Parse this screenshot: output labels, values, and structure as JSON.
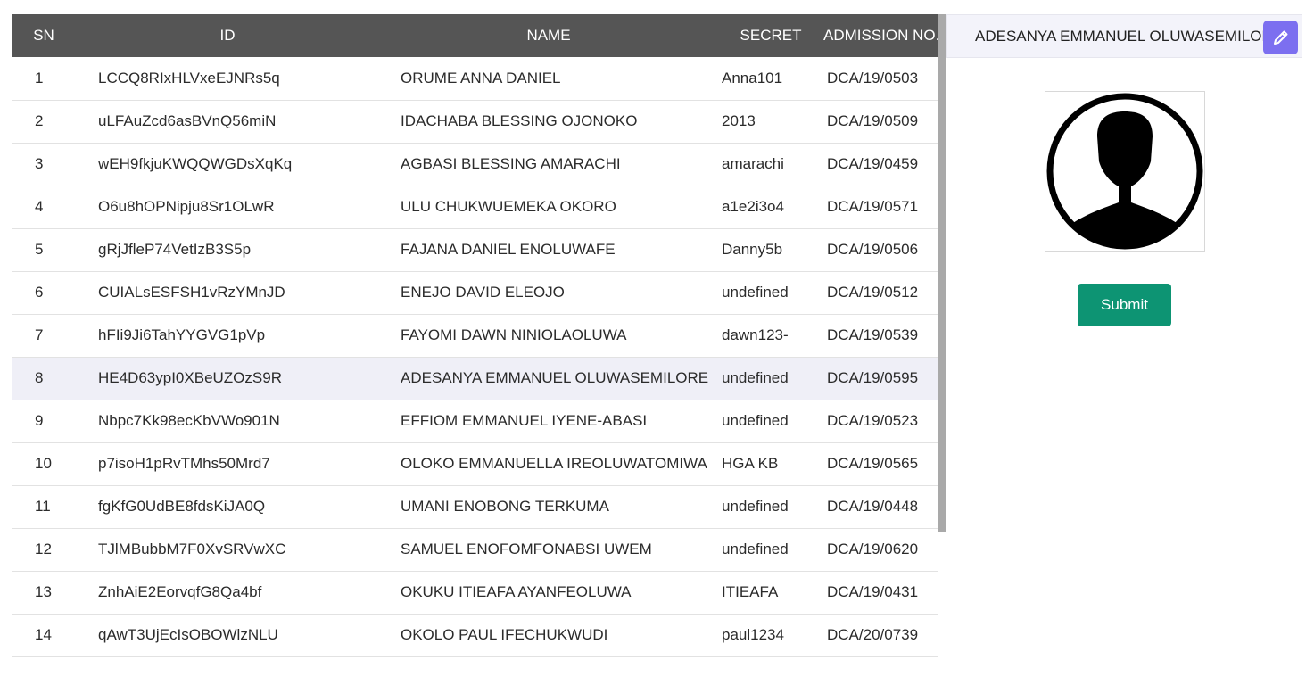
{
  "table": {
    "headers": {
      "sn": "SN",
      "id": "ID",
      "name": "NAME",
      "secret": "SECRET",
      "admission": "ADMISSION NO."
    },
    "rows": [
      {
        "sn": "1",
        "id": "LCCQ8RIxHLVxeEJNRs5q",
        "name": "ORUME ANNA DANIEL",
        "secret": "Anna101",
        "admission": "DCA/19/0503"
      },
      {
        "sn": "2",
        "id": "uLFAuZcd6asBVnQ56miN",
        "name": "IDACHABA BLESSING OJONOKO",
        "secret": "2013",
        "admission": "DCA/19/0509"
      },
      {
        "sn": "3",
        "id": "wEH9fkjuKWQQWGDsXqKq",
        "name": "AGBASI BLESSING AMARACHI",
        "secret": "amarachi",
        "admission": "DCA/19/0459"
      },
      {
        "sn": "4",
        "id": "O6u8hOPNipju8Sr1OLwR",
        "name": "ULU CHUKWUEMEKA OKORO",
        "secret": "a1e2i3o4",
        "admission": "DCA/19/0571"
      },
      {
        "sn": "5",
        "id": "gRjJfleP74VetIzB3S5p",
        "name": "FAJANA DANIEL ENOLUWAFE",
        "secret": "Danny5b",
        "admission": "DCA/19/0506"
      },
      {
        "sn": "6",
        "id": "CUIALsESFSH1vRzYMnJD",
        "name": "ENEJO DAVID ELEOJO",
        "secret": "undefined",
        "admission": "DCA/19/0512"
      },
      {
        "sn": "7",
        "id": "hFIi9Ji6TahYYGVG1pVp",
        "name": "FAYOMI DAWN NINIOLAOLUWA",
        "secret": "dawn123-",
        "admission": "DCA/19/0539"
      },
      {
        "sn": "8",
        "id": "HE4D63ypI0XBeUZOzS9R",
        "name": "ADESANYA EMMANUEL OLUWASEMILORE",
        "secret": "undefined",
        "admission": "DCA/19/0595"
      },
      {
        "sn": "9",
        "id": "Nbpc7Kk98ecKbVWo901N",
        "name": "EFFIOM EMMANUEL IYENE-ABASI",
        "secret": "undefined",
        "admission": "DCA/19/0523"
      },
      {
        "sn": "10",
        "id": "p7isoH1pRvTMhs50Mrd7",
        "name": "OLOKO EMMANUELLA IREOLUWATOMIWA",
        "secret": "HGA KB",
        "admission": "DCA/19/0565"
      },
      {
        "sn": "11",
        "id": "fgKfG0UdBE8fdsKiJA0Q",
        "name": "UMANI ENOBONG TERKUMA",
        "secret": "undefined",
        "admission": "DCA/19/0448"
      },
      {
        "sn": "12",
        "id": "TJlMBubbM7F0XvSRVwXC",
        "name": "SAMUEL ENOFOMFONABSI UWEM",
        "secret": "undefined",
        "admission": "DCA/19/0620"
      },
      {
        "sn": "13",
        "id": "ZnhAiE2EorvqfG8Qa4bf",
        "name": "OKUKU ITIEAFA AYANFEOLUWA",
        "secret": "ITIEAFA",
        "admission": "DCA/19/0431"
      },
      {
        "sn": "14",
        "id": "qAwT3UjEcIsOBOWlzNLU",
        "name": "OKOLO PAUL IFECHUKWUDI",
        "secret": "paul1234",
        "admission": "DCA/20/0739"
      }
    ],
    "selected_row_index": 7
  },
  "detail_panel": {
    "student_name": "ADESANYA EMMANUEL OLUWASEMILORE",
    "edit_icon": "pencil-icon",
    "avatar_icon": "user-avatar-icon",
    "submit_label": "Submit"
  },
  "colors": {
    "header_bg": "#555555",
    "selected_row_bg": "#efeff7",
    "edit_button_bg": "#7c6ff0",
    "submit_button_bg": "#0d9473"
  }
}
